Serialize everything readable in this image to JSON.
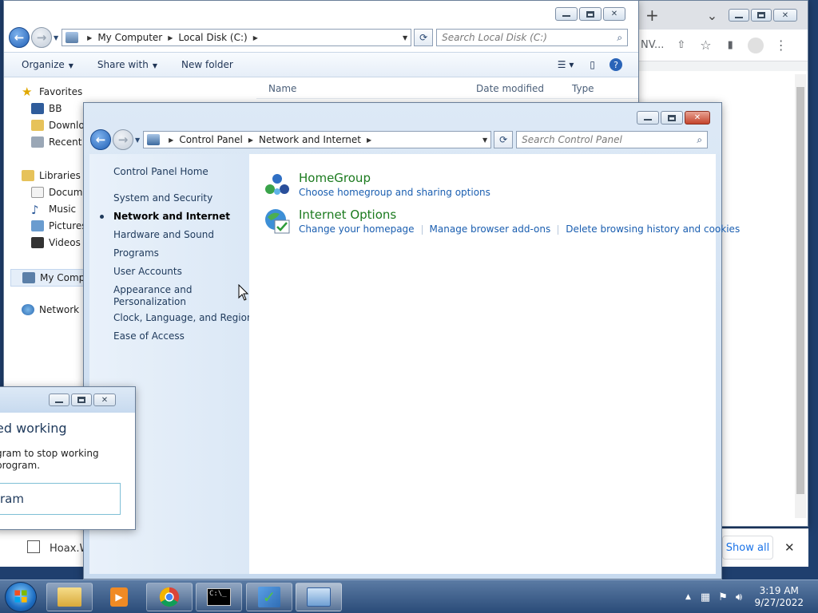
{
  "explorer": {
    "address": {
      "crumbs": [
        "My Computer",
        "Local Disk (C:)"
      ]
    },
    "search_placeholder": "Search Local Disk (C:)",
    "toolbar": {
      "organize": "Organize",
      "share_with": "Share with",
      "new_folder": "New folder"
    },
    "columns": {
      "name": "Name",
      "date_modified": "Date modified",
      "type": "Type"
    },
    "tree": {
      "favorites": "Favorites",
      "bb": "BB",
      "downloads": "Downloa",
      "recent": "Recent P",
      "libraries": "Libraries",
      "documents": "Docume",
      "music": "Music",
      "pictures": "Pictures",
      "videos": "Videos",
      "my_computer": "My Compu",
      "network": "Network"
    }
  },
  "control_panel": {
    "address": {
      "crumbs": [
        "Control Panel",
        "Network and Internet"
      ]
    },
    "search_placeholder": "Search Control Panel",
    "nav": {
      "home": "Control Panel Home",
      "system_security": "System and Security",
      "network_internet": "Network and Internet",
      "hardware_sound": "Hardware and Sound",
      "programs": "Programs",
      "user_accounts": "User Accounts",
      "appearance_1": "Appearance and",
      "appearance_2": "Personalization",
      "clock": "Clock, Language, and Region",
      "ease": "Ease of Access"
    },
    "categories": {
      "homegroup": {
        "title": "HomeGroup",
        "link1": "Choose homegroup and sharing options"
      },
      "internet_options": {
        "title": "Internet Options",
        "link1": "Change your homepage",
        "link2": "Manage browser add-ons",
        "link3": "Delete browsing history and cookies"
      }
    }
  },
  "browser": {
    "tab_new": "+",
    "tab_drop": "⌄",
    "url_fragment": "NV..."
  },
  "downloads": {
    "file": "Hoax.W",
    "show_all": "Show all",
    "close": "✕"
  },
  "dialog": {
    "title_fragment": "ed working",
    "body1": "gram to stop working",
    "body2": "program.",
    "button_fragment": "ram"
  },
  "taskbar": {
    "time": "3:19 AM",
    "date": "9/27/2022"
  },
  "colors": {
    "link_blue": "#1a5eb0",
    "category_green": "#1b7a1e",
    "close_red": "#c4442c"
  }
}
